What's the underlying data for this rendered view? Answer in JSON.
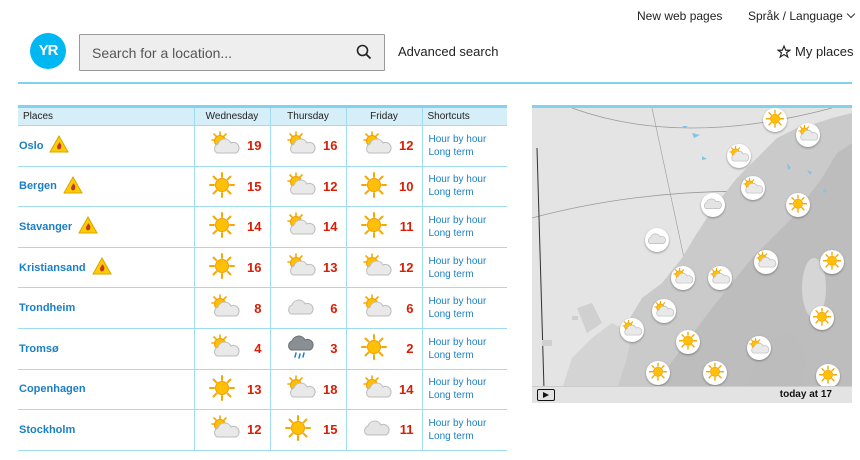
{
  "header": {
    "new_pages": "New web pages",
    "language": "Språk / Language",
    "logo": "YR",
    "search_placeholder": "Search for a location...",
    "advanced_search": "Advanced search",
    "my_places": "My places"
  },
  "table": {
    "col_places": "Places",
    "col_days": [
      "Wednesday",
      "Thursday",
      "Friday"
    ],
    "col_shortcuts": "Shortcuts",
    "rows": [
      {
        "place": "Oslo",
        "warning": true,
        "forecast": [
          {
            "icon": "partly-cloudy-icon",
            "temp": "19"
          },
          {
            "icon": "partly-cloudy-icon",
            "temp": "16"
          },
          {
            "icon": "partly-cloudy-icon",
            "temp": "12"
          }
        ],
        "link1": "Hour by hour",
        "link2": "Long term"
      },
      {
        "place": "Bergen",
        "warning": true,
        "forecast": [
          {
            "icon": "sun-icon",
            "temp": "15"
          },
          {
            "icon": "partly-cloudy-icon",
            "temp": "12"
          },
          {
            "icon": "sun-icon",
            "temp": "10"
          }
        ],
        "link1": "Hour by hour",
        "link2": "Long term"
      },
      {
        "place": "Stavanger",
        "warning": true,
        "forecast": [
          {
            "icon": "sun-icon",
            "temp": "14"
          },
          {
            "icon": "partly-cloudy-icon",
            "temp": "14"
          },
          {
            "icon": "sun-icon",
            "temp": "11"
          }
        ],
        "link1": "Hour by hour",
        "link2": "Long term"
      },
      {
        "place": "Kristiansand",
        "warning": true,
        "forecast": [
          {
            "icon": "sun-icon",
            "temp": "16"
          },
          {
            "icon": "partly-cloudy-icon",
            "temp": "13"
          },
          {
            "icon": "partly-cloudy-icon",
            "temp": "12"
          }
        ],
        "link1": "Hour by hour",
        "link2": "Long term"
      },
      {
        "place": "Trondheim",
        "warning": false,
        "forecast": [
          {
            "icon": "partly-cloudy-icon",
            "temp": "8"
          },
          {
            "icon": "cloud-icon",
            "temp": "6"
          },
          {
            "icon": "partly-cloudy-icon",
            "temp": "6"
          }
        ],
        "link1": "Hour by hour",
        "link2": "Long term"
      },
      {
        "place": "Tromsø",
        "warning": false,
        "forecast": [
          {
            "icon": "partly-cloudy-icon",
            "temp": "4"
          },
          {
            "icon": "rain-cloud-icon",
            "temp": "3"
          },
          {
            "icon": "sun-icon",
            "temp": "2"
          }
        ],
        "link1": "Hour by hour",
        "link2": "Long term"
      },
      {
        "place": "Copenhagen",
        "warning": false,
        "forecast": [
          {
            "icon": "sun-icon",
            "temp": "13"
          },
          {
            "icon": "partly-cloudy-icon",
            "temp": "18"
          },
          {
            "icon": "partly-cloudy-icon",
            "temp": "14"
          }
        ],
        "link1": "Hour by hour",
        "link2": "Long term"
      },
      {
        "place": "Stockholm",
        "warning": false,
        "forecast": [
          {
            "icon": "partly-cloudy-icon",
            "temp": "12"
          },
          {
            "icon": "sun-icon",
            "temp": "15"
          },
          {
            "icon": "cloud-icon",
            "temp": "11"
          }
        ],
        "link1": "Hour by hour",
        "link2": "Long term"
      }
    ]
  },
  "map": {
    "label": "today at 17"
  },
  "colors": {
    "accent": "#7fd3ec",
    "link": "#1b7fc4",
    "temp": "#d81e05",
    "logo": "#00b8f1"
  }
}
